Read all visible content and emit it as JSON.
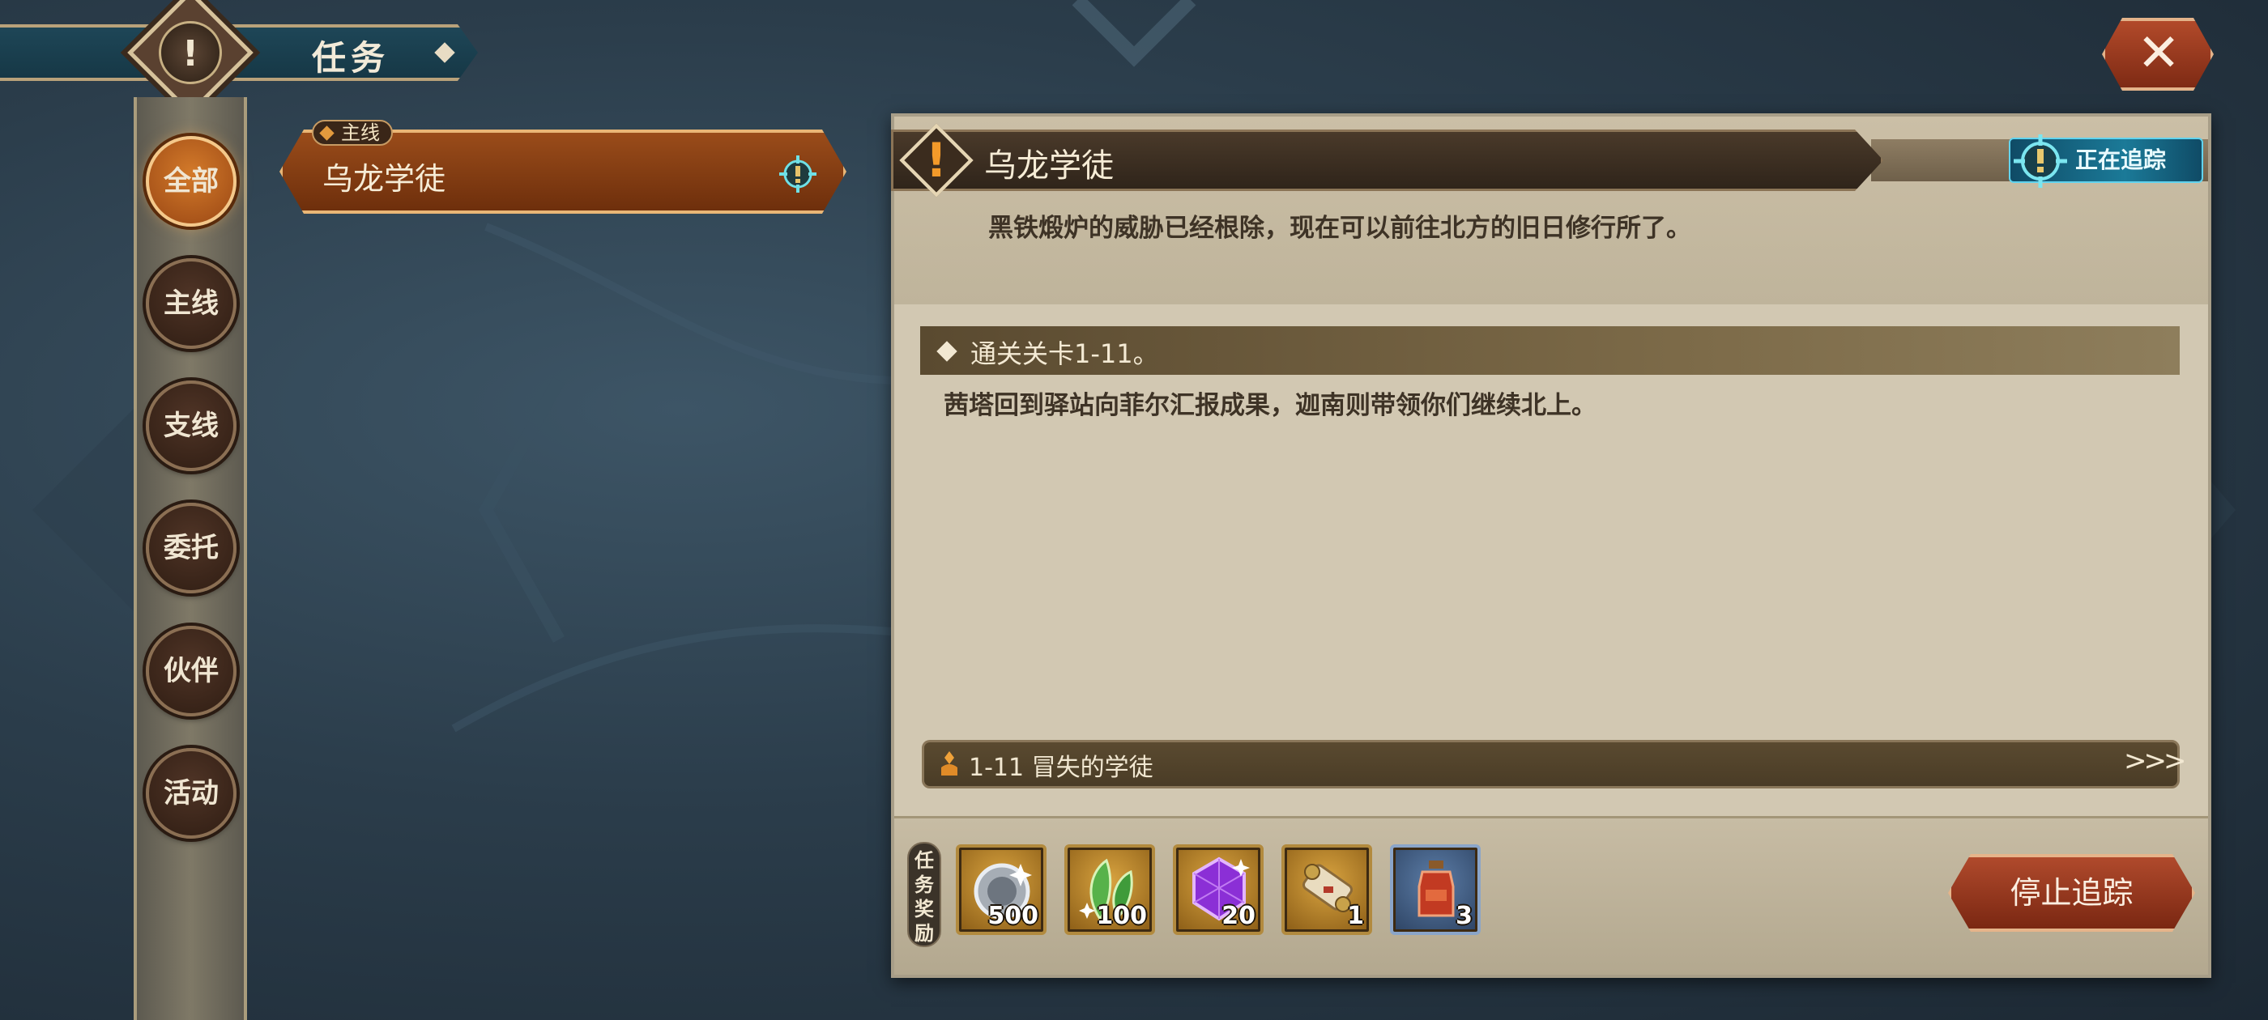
{
  "header": {
    "title": "任务",
    "close_icon": "close-icon"
  },
  "tabs": [
    {
      "label": "全部",
      "active": true
    },
    {
      "label": "主线",
      "active": false
    },
    {
      "label": "支线",
      "active": false
    },
    {
      "label": "委托",
      "active": false
    },
    {
      "label": "伙伴",
      "active": false
    },
    {
      "label": "活动",
      "active": false
    }
  ],
  "quest_list": [
    {
      "tag": "主线",
      "name": "乌龙学徒",
      "tracked": true
    }
  ],
  "detail": {
    "title": "乌龙学徒",
    "tracking_label": "正在追踪",
    "description": "黑铁煅炉的威胁已经根除，现在可以前往北方的旧日修行所了。",
    "objective": "通关关卡1-11。",
    "objective_description": "茜塔回到驿站向菲尔汇报成果，迦南则带领你们继续北上。",
    "stage": "1-11 冒失的学徒",
    "stage_arrow": ">>>"
  },
  "rewards": {
    "label": "任务奖励",
    "items": [
      {
        "icon": "silver-coin-icon",
        "count": "500"
      },
      {
        "icon": "green-leaf-icon",
        "count": "100"
      },
      {
        "icon": "purple-gem-icon",
        "count": "20"
      },
      {
        "icon": "scroll-icon",
        "count": "1"
      },
      {
        "icon": "red-potion-icon",
        "count": "3"
      }
    ]
  },
  "actions": {
    "stop_tracking": "停止追踪"
  },
  "colors": {
    "accent_orange": "#d37a2a",
    "panel": "#d2c8b2",
    "tracking_cyan": "#1b7a98",
    "button_red": "#b04a2c"
  }
}
